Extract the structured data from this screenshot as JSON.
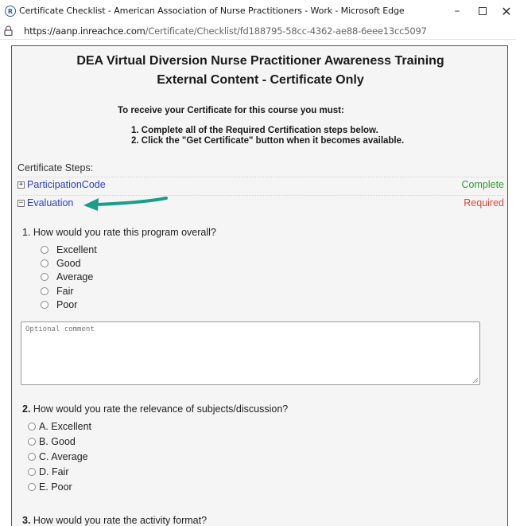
{
  "window": {
    "title": "Certificate Checklist - American Association of Nurse Practitioners - Work - Microsoft Edge",
    "minimize": "–",
    "close": "✕"
  },
  "address": {
    "domain": "https://aanp.inreachce.com",
    "path": "/Certificate/Checklist/fd188795-58cc-4362-ae88-6eee13cc5097"
  },
  "course": {
    "title_line1": "DEA Virtual Diversion Nurse Practitioner Awareness Training",
    "title_line2": "External Content - Certificate Only"
  },
  "instructions": {
    "heading": "To receive your Certificate for this course you must:",
    "step1": "1. Complete all of the Required Certification steps below.",
    "step2": "2. Click the \"Get Certificate\" button when it becomes available."
  },
  "steps": {
    "label": "Certificate Steps:",
    "items": [
      {
        "toggle": "+",
        "name": "ParticipationCode",
        "status": "Complete"
      },
      {
        "toggle": "−",
        "name": "Evaluation",
        "status": "Required"
      }
    ]
  },
  "evaluation": {
    "q1": {
      "text": "1. How would you rate this program overall?",
      "options": [
        "Excellent",
        "Good",
        "Average",
        "Fair",
        "Poor"
      ],
      "comment_placeholder": "Optional comment"
    },
    "q2": {
      "number": "2.",
      "text": " How would you rate the relevance of subjects/discussion?",
      "options": [
        "A. Excellent",
        "B. Good",
        "C. Average",
        "D. Fair",
        "E. Poor"
      ]
    },
    "q3": {
      "number": "3.",
      "text": " How would you rate the activity format?"
    }
  },
  "colors": {
    "link": "#2c3fc8",
    "complete": "#2e9b2e",
    "required": "#e0453a",
    "arrow": "#1a9e8a"
  }
}
